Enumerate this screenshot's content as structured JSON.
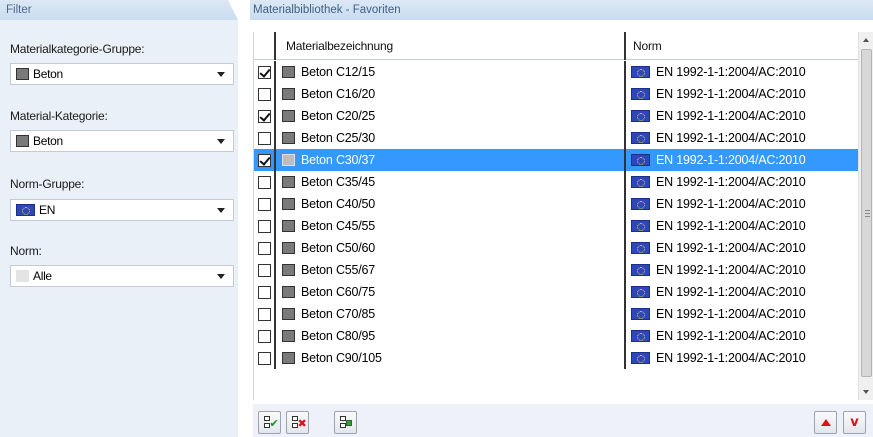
{
  "filter": {
    "header": "Filter",
    "material_category_group": {
      "label": "Materialkategorie-Gruppe:",
      "value": "Beton",
      "icon": "gray-swatch-icon"
    },
    "material_category": {
      "label": "Material-Kategorie:",
      "value": "Beton",
      "icon": "gray-swatch-icon"
    },
    "norm_group": {
      "label": "Norm-Gruppe:",
      "value": "EN",
      "icon": "eu-flag-icon"
    },
    "norm": {
      "label": "Norm:",
      "value": "Alle",
      "icon": "blank-swatch-icon"
    }
  },
  "library": {
    "header": "Materialbibliothek - Favoriten",
    "columns": {
      "name": "Materialbezeichnung",
      "norm": "Norm"
    },
    "rows": [
      {
        "checked": true,
        "name": "Beton C12/15",
        "norm": "EN 1992-1-1:2004/AC:2010",
        "selected": false
      },
      {
        "checked": false,
        "name": "Beton C16/20",
        "norm": "EN 1992-1-1:2004/AC:2010",
        "selected": false
      },
      {
        "checked": true,
        "name": "Beton C20/25",
        "norm": "EN 1992-1-1:2004/AC:2010",
        "selected": false
      },
      {
        "checked": false,
        "name": "Beton C25/30",
        "norm": "EN 1992-1-1:2004/AC:2010",
        "selected": false
      },
      {
        "checked": true,
        "name": "Beton C30/37",
        "norm": "EN 1992-1-1:2004/AC:2010",
        "selected": true
      },
      {
        "checked": false,
        "name": "Beton C35/45",
        "norm": "EN 1992-1-1:2004/AC:2010",
        "selected": false
      },
      {
        "checked": false,
        "name": "Beton C40/50",
        "norm": "EN 1992-1-1:2004/AC:2010",
        "selected": false
      },
      {
        "checked": false,
        "name": "Beton C45/55",
        "norm": "EN 1992-1-1:2004/AC:2010",
        "selected": false
      },
      {
        "checked": false,
        "name": "Beton C50/60",
        "norm": "EN 1992-1-1:2004/AC:2010",
        "selected": false
      },
      {
        "checked": false,
        "name": "Beton C55/67",
        "norm": "EN 1992-1-1:2004/AC:2010",
        "selected": false
      },
      {
        "checked": false,
        "name": "Beton C60/75",
        "norm": "EN 1992-1-1:2004/AC:2010",
        "selected": false
      },
      {
        "checked": false,
        "name": "Beton C70/85",
        "norm": "EN 1992-1-1:2004/AC:2010",
        "selected": false
      },
      {
        "checked": false,
        "name": "Beton C80/95",
        "norm": "EN 1992-1-1:2004/AC:2010",
        "selected": false
      },
      {
        "checked": false,
        "name": "Beton C90/105",
        "norm": "EN 1992-1-1:2004/AC:2010",
        "selected": false
      }
    ]
  },
  "toolbar": {
    "buttons": [
      "select-all-icon",
      "deselect-all-icon",
      "invert-selection-icon"
    ],
    "move_buttons": [
      "move-up-icon",
      "move-down-icon"
    ]
  },
  "colors": {
    "selection": "#3399ff",
    "panel_bg": "#eaf0f8",
    "header_text": "#3f5f83",
    "accent_red": "#d8141a"
  }
}
